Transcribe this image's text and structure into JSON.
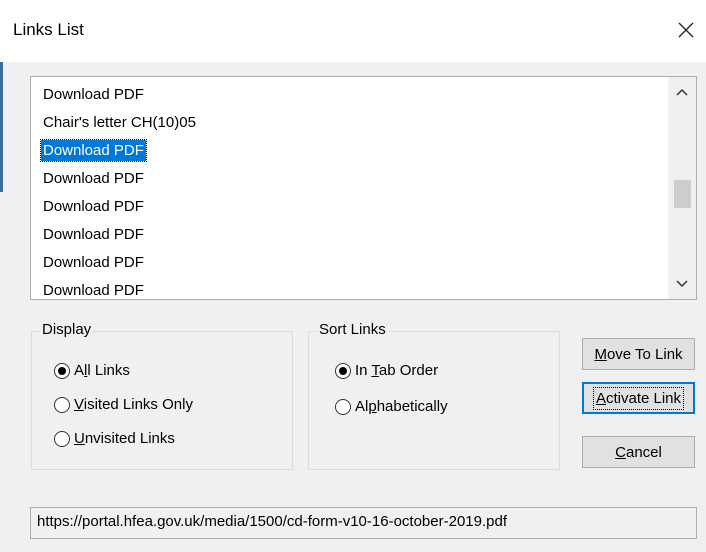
{
  "window": {
    "title": "Links List",
    "close_icon": "close-icon"
  },
  "links_list": {
    "items": [
      {
        "label": "Download PDF",
        "selected": false
      },
      {
        "label": "Chair's letter CH(10)05",
        "selected": false
      },
      {
        "label": "Download PDF",
        "selected": true
      },
      {
        "label": "Download PDF",
        "selected": false
      },
      {
        "label": "Download PDF",
        "selected": false
      },
      {
        "label": "Download PDF",
        "selected": false
      },
      {
        "label": "Download PDF",
        "selected": false
      },
      {
        "label": "Download PDF",
        "selected": false
      }
    ],
    "scroll_up_icon": "chevron-up-icon",
    "scroll_down_icon": "chevron-down-icon"
  },
  "display_group": {
    "label": "Display",
    "options": [
      {
        "label_pre": "A",
        "accel": "l",
        "label_post": "l Links",
        "checked": true
      },
      {
        "label_pre": "",
        "accel": "V",
        "label_post": "isited Links Only",
        "checked": false
      },
      {
        "label_pre": "",
        "accel": "U",
        "label_post": "nvisited Links",
        "checked": false
      }
    ]
  },
  "sort_group": {
    "label": "Sort Links",
    "options": [
      {
        "label_pre": "In ",
        "accel": "T",
        "label_post": "ab Order",
        "checked": true
      },
      {
        "label_pre": "Al",
        "accel": "p",
        "label_post": "habetically",
        "checked": false
      }
    ]
  },
  "buttons": {
    "move_to_link": {
      "pre": "",
      "accel": "M",
      "post": "ove To Link"
    },
    "activate_link": {
      "pre": "",
      "accel": "A",
      "post": "ctivate Link"
    },
    "cancel": {
      "pre": "",
      "accel": "C",
      "post": "ancel"
    }
  },
  "status": {
    "url": "https://portal.hfea.gov.uk/media/1500/cd-form-v10-16-october-2019.pdf"
  }
}
